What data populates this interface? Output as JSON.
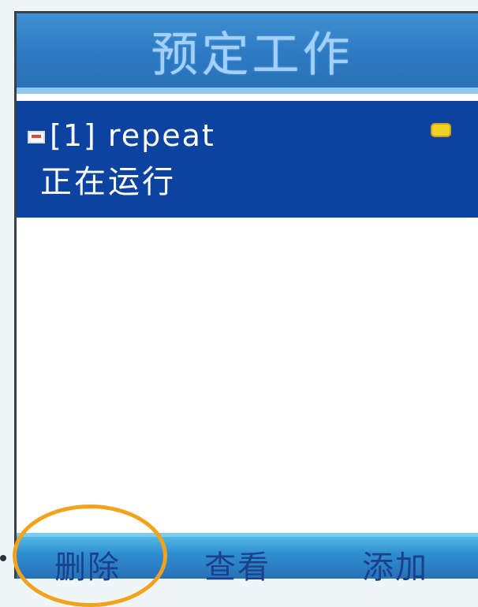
{
  "header": {
    "title": "预定工作"
  },
  "list": {
    "items": [
      {
        "line1": "[1] repeat",
        "line2": "正在运行",
        "left_icon": "mail-icon",
        "right_icon": "flag-icon"
      }
    ]
  },
  "softkeys": {
    "left": "删除",
    "center": "查看",
    "right": "添加"
  },
  "colors": {
    "title_bar": "#2d79c2",
    "selected_row": "#0d43a0",
    "softkey_bar": "#2e8ecf",
    "highlight_ring": "#f3a21c"
  }
}
